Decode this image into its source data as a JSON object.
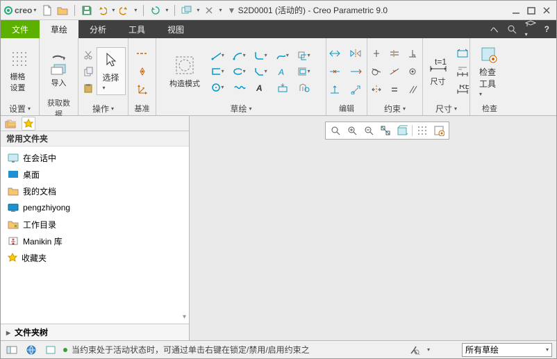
{
  "app": {
    "brand": "creo",
    "title": "S2D0001 (活动的) - Creo Parametric 9.0"
  },
  "menu": {
    "file": "文件",
    "tabs": [
      "草绘",
      "分析",
      "工具",
      "视图"
    ],
    "activeIndex": 0
  },
  "ribbon": {
    "grid": {
      "label": "栅格设置",
      "footer": "设置"
    },
    "import": {
      "label": "导入",
      "footer": "获取数据"
    },
    "operate": {
      "select": "选择",
      "footer": "操作"
    },
    "datum": {
      "footer": "基准"
    },
    "construct": {
      "label": "构造模式"
    },
    "sketch": {
      "footer": "草绘"
    },
    "edit": {
      "footer": "编辑"
    },
    "constraint": {
      "footer": "约束"
    },
    "dimension": {
      "label": "尺寸",
      "footer": "尺寸"
    },
    "inspect": {
      "label": "检查工具",
      "footer": "检查"
    }
  },
  "folders": {
    "header": "常用文件夹",
    "items": [
      {
        "icon": "monitor",
        "label": "在会话中"
      },
      {
        "icon": "desktop",
        "label": "桌面"
      },
      {
        "icon": "docs",
        "label": "我的文档"
      },
      {
        "icon": "computer",
        "label": "pengzhiyong"
      },
      {
        "icon": "workdir",
        "label": "工作目录"
      },
      {
        "icon": "manikin",
        "label": "Manikin 库"
      },
      {
        "icon": "fav",
        "label": "收藏夹"
      }
    ],
    "tree": "文件夹树"
  },
  "status": {
    "msg": "当约束处于活动状态时，可通过单击右键在锁定/禁用/启用约束之",
    "combo": "所有草绘"
  }
}
